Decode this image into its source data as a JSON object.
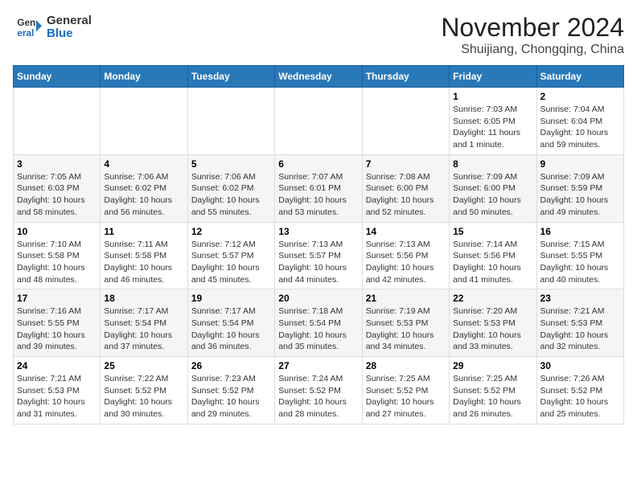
{
  "header": {
    "logo_line1": "General",
    "logo_line2": "Blue",
    "month": "November 2024",
    "location": "Shuijiang, Chongqing, China"
  },
  "weekdays": [
    "Sunday",
    "Monday",
    "Tuesday",
    "Wednesday",
    "Thursday",
    "Friday",
    "Saturday"
  ],
  "weeks": [
    [
      {
        "day": "",
        "info": ""
      },
      {
        "day": "",
        "info": ""
      },
      {
        "day": "",
        "info": ""
      },
      {
        "day": "",
        "info": ""
      },
      {
        "day": "",
        "info": ""
      },
      {
        "day": "1",
        "info": "Sunrise: 7:03 AM\nSunset: 6:05 PM\nDaylight: 11 hours and 1 minute."
      },
      {
        "day": "2",
        "info": "Sunrise: 7:04 AM\nSunset: 6:04 PM\nDaylight: 10 hours and 59 minutes."
      }
    ],
    [
      {
        "day": "3",
        "info": "Sunrise: 7:05 AM\nSunset: 6:03 PM\nDaylight: 10 hours and 58 minutes."
      },
      {
        "day": "4",
        "info": "Sunrise: 7:06 AM\nSunset: 6:02 PM\nDaylight: 10 hours and 56 minutes."
      },
      {
        "day": "5",
        "info": "Sunrise: 7:06 AM\nSunset: 6:02 PM\nDaylight: 10 hours and 55 minutes."
      },
      {
        "day": "6",
        "info": "Sunrise: 7:07 AM\nSunset: 6:01 PM\nDaylight: 10 hours and 53 minutes."
      },
      {
        "day": "7",
        "info": "Sunrise: 7:08 AM\nSunset: 6:00 PM\nDaylight: 10 hours and 52 minutes."
      },
      {
        "day": "8",
        "info": "Sunrise: 7:09 AM\nSunset: 6:00 PM\nDaylight: 10 hours and 50 minutes."
      },
      {
        "day": "9",
        "info": "Sunrise: 7:09 AM\nSunset: 5:59 PM\nDaylight: 10 hours and 49 minutes."
      }
    ],
    [
      {
        "day": "10",
        "info": "Sunrise: 7:10 AM\nSunset: 5:58 PM\nDaylight: 10 hours and 48 minutes."
      },
      {
        "day": "11",
        "info": "Sunrise: 7:11 AM\nSunset: 5:58 PM\nDaylight: 10 hours and 46 minutes."
      },
      {
        "day": "12",
        "info": "Sunrise: 7:12 AM\nSunset: 5:57 PM\nDaylight: 10 hours and 45 minutes."
      },
      {
        "day": "13",
        "info": "Sunrise: 7:13 AM\nSunset: 5:57 PM\nDaylight: 10 hours and 44 minutes."
      },
      {
        "day": "14",
        "info": "Sunrise: 7:13 AM\nSunset: 5:56 PM\nDaylight: 10 hours and 42 minutes."
      },
      {
        "day": "15",
        "info": "Sunrise: 7:14 AM\nSunset: 5:56 PM\nDaylight: 10 hours and 41 minutes."
      },
      {
        "day": "16",
        "info": "Sunrise: 7:15 AM\nSunset: 5:55 PM\nDaylight: 10 hours and 40 minutes."
      }
    ],
    [
      {
        "day": "17",
        "info": "Sunrise: 7:16 AM\nSunset: 5:55 PM\nDaylight: 10 hours and 39 minutes."
      },
      {
        "day": "18",
        "info": "Sunrise: 7:17 AM\nSunset: 5:54 PM\nDaylight: 10 hours and 37 minutes."
      },
      {
        "day": "19",
        "info": "Sunrise: 7:17 AM\nSunset: 5:54 PM\nDaylight: 10 hours and 36 minutes."
      },
      {
        "day": "20",
        "info": "Sunrise: 7:18 AM\nSunset: 5:54 PM\nDaylight: 10 hours and 35 minutes."
      },
      {
        "day": "21",
        "info": "Sunrise: 7:19 AM\nSunset: 5:53 PM\nDaylight: 10 hours and 34 minutes."
      },
      {
        "day": "22",
        "info": "Sunrise: 7:20 AM\nSunset: 5:53 PM\nDaylight: 10 hours and 33 minutes."
      },
      {
        "day": "23",
        "info": "Sunrise: 7:21 AM\nSunset: 5:53 PM\nDaylight: 10 hours and 32 minutes."
      }
    ],
    [
      {
        "day": "24",
        "info": "Sunrise: 7:21 AM\nSunset: 5:53 PM\nDaylight: 10 hours and 31 minutes."
      },
      {
        "day": "25",
        "info": "Sunrise: 7:22 AM\nSunset: 5:52 PM\nDaylight: 10 hours and 30 minutes."
      },
      {
        "day": "26",
        "info": "Sunrise: 7:23 AM\nSunset: 5:52 PM\nDaylight: 10 hours and 29 minutes."
      },
      {
        "day": "27",
        "info": "Sunrise: 7:24 AM\nSunset: 5:52 PM\nDaylight: 10 hours and 28 minutes."
      },
      {
        "day": "28",
        "info": "Sunrise: 7:25 AM\nSunset: 5:52 PM\nDaylight: 10 hours and 27 minutes."
      },
      {
        "day": "29",
        "info": "Sunrise: 7:25 AM\nSunset: 5:52 PM\nDaylight: 10 hours and 26 minutes."
      },
      {
        "day": "30",
        "info": "Sunrise: 7:26 AM\nSunset: 5:52 PM\nDaylight: 10 hours and 25 minutes."
      }
    ]
  ]
}
